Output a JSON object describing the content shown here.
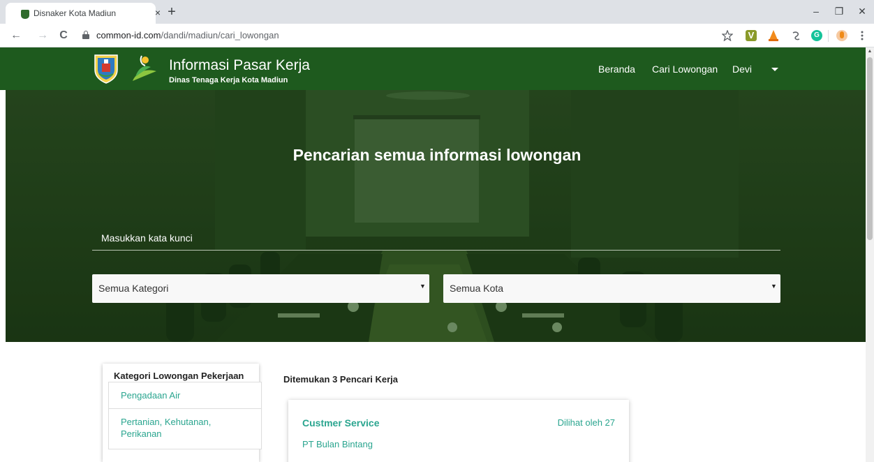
{
  "browser": {
    "tab_title": "Disnaker Kota Madiun",
    "tab_close": "×",
    "new_tab": "+",
    "url_host": "common-id.com",
    "url_path": "/dandi/madiun/cari_lowongan",
    "window_controls": {
      "minimize": "–",
      "maximize": "❐",
      "close": "✕"
    },
    "nav": {
      "back": "←",
      "forward": "→",
      "reload": "C"
    },
    "toolbar_icons": [
      "star-icon",
      "extension-v-icon",
      "extension-cone-icon",
      "extension-swirl-icon",
      "extension-grammarly-icon",
      "profile-avatar-icon",
      "more-menu-icon"
    ]
  },
  "site": {
    "brand_title": "Informasi Pasar Kerja",
    "brand_subtitle": "Dinas Tenaga Kerja Kota Madiun",
    "nav": {
      "home": "Beranda",
      "search_jobs": "Cari Lowongan",
      "user": "Devi"
    },
    "accent_color": "#1e5a1e",
    "link_color": "#2aa58f"
  },
  "hero": {
    "title": "Pencarian semua informasi lowongan",
    "keyword_placeholder": "Masukkan kata kunci",
    "category_select": "Semua Kategori",
    "city_select": "Semua Kota"
  },
  "sidebar": {
    "title": "Kategori Lowongan Pekerjaan",
    "items": [
      {
        "label": "Pengadaan Air"
      },
      {
        "label": "Pertanian, Kehutanan, Perikanan"
      }
    ]
  },
  "results": {
    "summary": "Ditemukan 3 Pencari Kerja",
    "jobs": [
      {
        "title": "Custmer Service",
        "views": "Dilihat oleh 27",
        "company": "PT Bulan Bintang"
      }
    ]
  }
}
